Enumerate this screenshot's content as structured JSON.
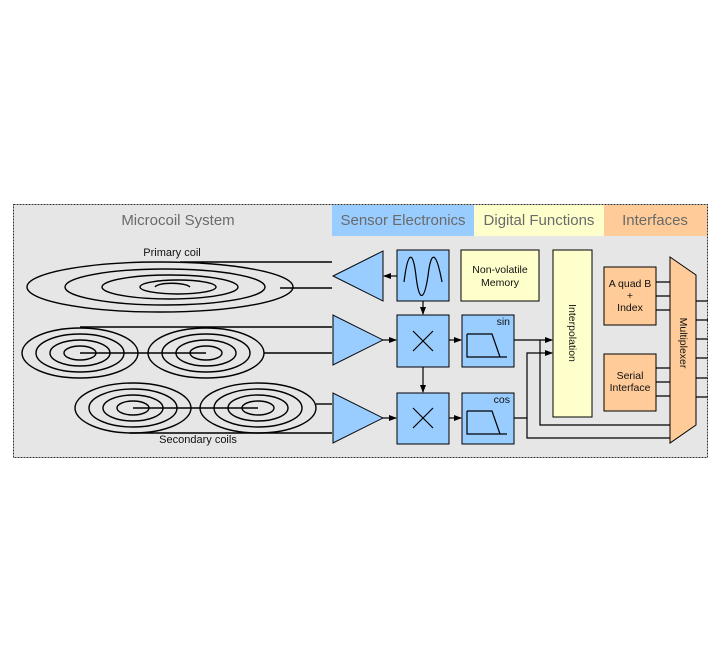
{
  "sections": {
    "microcoil": "Microcoil System",
    "sensor": "Sensor Electronics",
    "digital": "Digital Functions",
    "interfaces": "Interfaces"
  },
  "labels": {
    "primary_coil": "Primary coil",
    "secondary_coils": "Secondary coils",
    "memory_line1": "Non-volatile",
    "memory_line2": "Memory",
    "interpolation": "Interpolation",
    "aquadb_line1": "A quad B",
    "aquadb_line2": "+",
    "aquadb_line3": "Index",
    "serial_line1": "Serial",
    "serial_line2": "Interface",
    "multiplexer": "Multiplexer",
    "sin": "sin",
    "cos": "cos"
  },
  "colors": {
    "sensor": "#99ccff",
    "digital": "#ffffcc",
    "interfaces": "#ffcc99",
    "background": "#e6e6e6"
  }
}
